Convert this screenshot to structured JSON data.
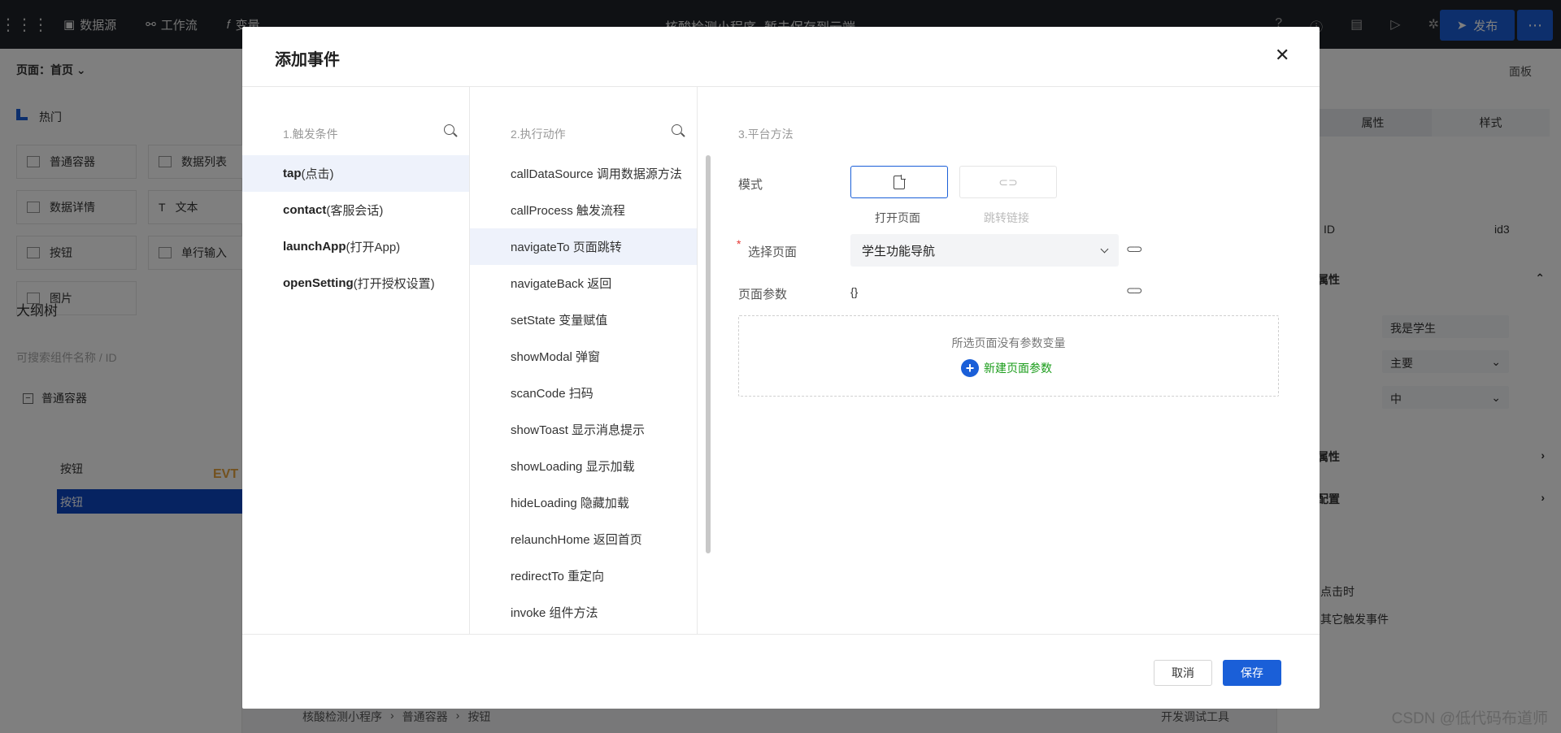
{
  "app": {
    "topbar": {
      "datasource": "数据源",
      "workflow": "工作流",
      "variable": "变量",
      "app_title": "核酸检测小程序",
      "save_status": "暂未保存到云端",
      "publish": "发布"
    },
    "left": {
      "page_selector": "页面：首页",
      "hot": "热门",
      "components": [
        "普通容器",
        "数据列表",
        "数据详情",
        "文本",
        "按钮",
        "单行输入",
        "图片"
      ],
      "outline_title": "大纲树",
      "search_placeholder": "可搜索组件名称 / ID",
      "tree_root": "普通容器",
      "tree_child_1": "按钮",
      "tree_child_2": "按钮",
      "evt_tag": "EVT"
    },
    "breadcrumb": [
      "核酸检测小程序",
      "普通容器",
      "按钮"
    ],
    "devtools": "开发调试工具",
    "right": {
      "board": "面板",
      "tab_props": "属性",
      "tab_style": "样式",
      "id_label": "ID",
      "id_value": "id3",
      "section_props": "属性",
      "text_value": "我是学生",
      "type_value": "主要",
      "size_value": "中",
      "section_props2": "属性",
      "section_config": "配置",
      "event_click": "点击时",
      "event_other": "其它触发事件"
    }
  },
  "modal": {
    "title": "添加事件",
    "close_icon": "close-icon",
    "col1": {
      "header": "1.触发条件",
      "items": [
        {
          "code": "tap",
          "desc": "(点击)"
        },
        {
          "code": "contact",
          "desc": "(客服会话)"
        },
        {
          "code": "launchApp",
          "desc": "(打开App)"
        },
        {
          "code": "openSetting",
          "desc": "(打开授权设置)"
        }
      ]
    },
    "col2": {
      "header": "2.执行动作",
      "items": [
        "callDataSource 调用数据源方法",
        "callProcess 触发流程",
        "navigateTo 页面跳转",
        "navigateBack 返回",
        "setState 变量赋值",
        "showModal 弹窗",
        "scanCode 扫码",
        "showToast 显示消息提示",
        "showLoading 显示加载",
        "hideLoading 隐藏加载",
        "relaunchHome 返回首页",
        "redirectTo 重定向",
        "invoke 组件方法"
      ]
    },
    "col3": {
      "header": "3.平台方法",
      "mode_label": "模式",
      "mode_open_page": "打开页面",
      "mode_jump_link": "跳转链接",
      "select_page_label": "选择页面",
      "select_page_value": "学生功能导航",
      "page_params_label": "页面参数",
      "page_params_value": "{}",
      "empty_text": "所选页面没有参数变量",
      "new_param": "新建页面参数"
    },
    "footer": {
      "cancel": "取消",
      "save": "保存"
    }
  },
  "watermark": "CSDN @低代码布道师",
  "colors": {
    "primary": "#1a5fd8",
    "active_row": "#eef2fb",
    "new_param": "#1a9c1a"
  }
}
